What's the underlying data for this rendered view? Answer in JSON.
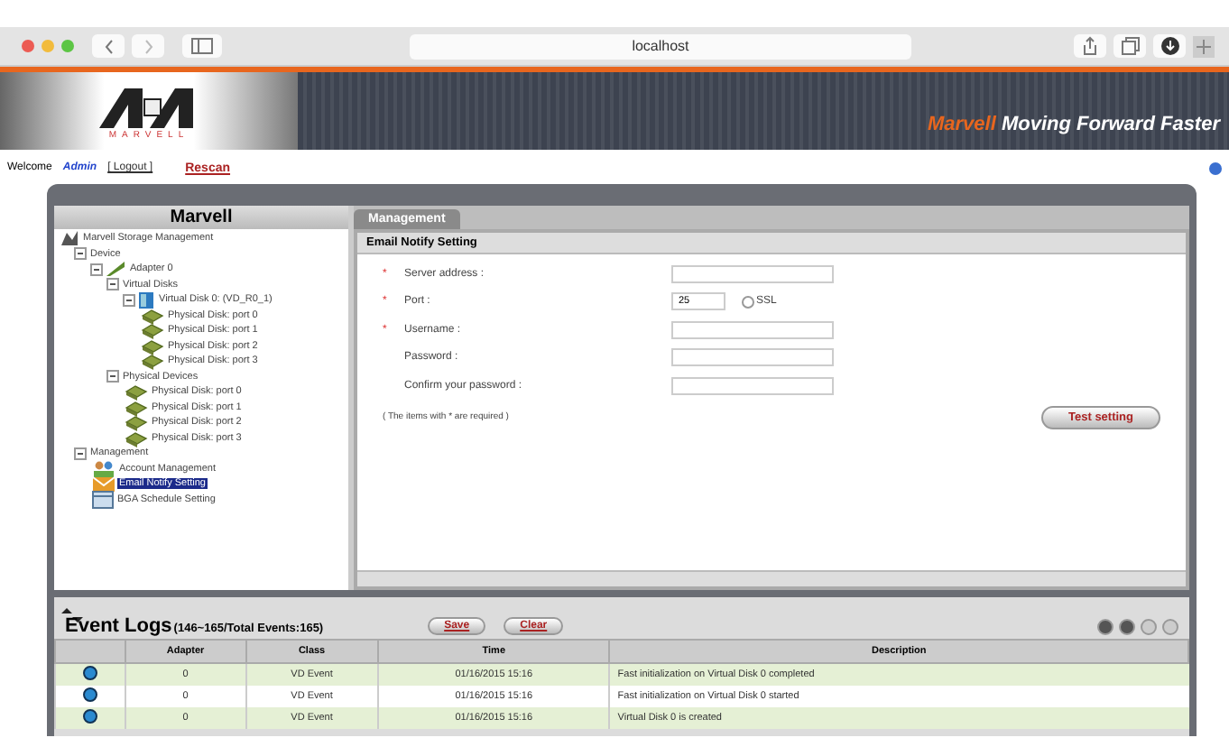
{
  "browser": {
    "address": "localhost"
  },
  "banner": {
    "brand": "MARVELL",
    "tagline_brand": "Marvell",
    "tagline": "Moving Forward Faster"
  },
  "user_bar": {
    "welcome": "Welcome",
    "user": "Admin",
    "logout": "[ Logout ]",
    "rescan": "Rescan"
  },
  "sidebar": {
    "title": "Marvell",
    "tree": [
      {
        "label": "Marvell Storage Management",
        "kind": "root",
        "selected": false,
        "children": [
          {
            "label": "Device",
            "selected": false,
            "expanded": true,
            "children": [
              {
                "label": "Adapter 0",
                "kind": "adapter",
                "selected": false,
                "expanded": true,
                "children": [
                  {
                    "label": "Virtual Disks",
                    "selected": false,
                    "expanded": true,
                    "children": [
                      {
                        "label": "Virtual Disk 0: (VD_R0_1)",
                        "kind": "vdisk",
                        "selected": false,
                        "expanded": true,
                        "children": [
                          {
                            "label": "Physical Disk: port 0",
                            "kind": "pdisk",
                            "selected": false
                          },
                          {
                            "label": "Physical Disk: port 1",
                            "kind": "pdisk",
                            "selected": false
                          },
                          {
                            "label": "Physical Disk: port 2",
                            "kind": "pdisk",
                            "selected": false
                          },
                          {
                            "label": "Physical Disk: port 3",
                            "kind": "pdisk",
                            "selected": false
                          }
                        ]
                      }
                    ]
                  },
                  {
                    "label": "Physical Devices",
                    "selected": false,
                    "expanded": true,
                    "children": [
                      {
                        "label": "Physical Disk: port 0",
                        "kind": "pdisk",
                        "selected": false
                      },
                      {
                        "label": "Physical Disk: port 1",
                        "kind": "pdisk",
                        "selected": false
                      },
                      {
                        "label": "Physical Disk: port 2",
                        "kind": "pdisk",
                        "selected": false
                      },
                      {
                        "label": "Physical Disk: port 3",
                        "kind": "pdisk",
                        "selected": false
                      }
                    ]
                  }
                ]
              }
            ]
          },
          {
            "label": "Management",
            "selected": false,
            "expanded": true,
            "children": [
              {
                "label": "Account Management",
                "kind": "account",
                "selected": false
              },
              {
                "label": "Email Notify Setting",
                "kind": "email",
                "selected": true
              },
              {
                "label": "BGA Schedule Setting",
                "kind": "schedule",
                "selected": false
              }
            ]
          }
        ]
      }
    ]
  },
  "tabs": [
    {
      "label": "Management",
      "selected": true
    }
  ],
  "panel": {
    "title": "Email Notify Setting",
    "fields": [
      {
        "label": "Server address :",
        "marker": "*"
      },
      {
        "label": "Port :",
        "marker": "*",
        "value": "25",
        "option": {
          "label": "SSL",
          "checked": false
        }
      },
      {
        "label": "Username :",
        "marker": "*"
      },
      {
        "label": "Password :"
      },
      {
        "label": "Confirm your password :"
      }
    ],
    "note": "( The items with * are required )",
    "test_button": "Test setting"
  },
  "event_log": {
    "title": "Event Logs",
    "range": "(146~165/Total Events:165)",
    "buttons": [
      "Save",
      "Clear"
    ],
    "columns": [
      "Adapter",
      "Class",
      "Time",
      "Description"
    ],
    "rows": [
      {
        "adapter": "0",
        "class": "VD Event",
        "time": "01/16/2015 15:16",
        "description": "Fast initialization on Virtual Disk 0 completed"
      },
      {
        "adapter": "0",
        "class": "VD Event",
        "time": "01/16/2015 15:16",
        "description": "Fast initialization on Virtual Disk 0 started"
      },
      {
        "adapter": "0",
        "class": "VD Event",
        "time": "01/16/2015 15:16",
        "description": "Virtual Disk 0 is created"
      }
    ]
  }
}
